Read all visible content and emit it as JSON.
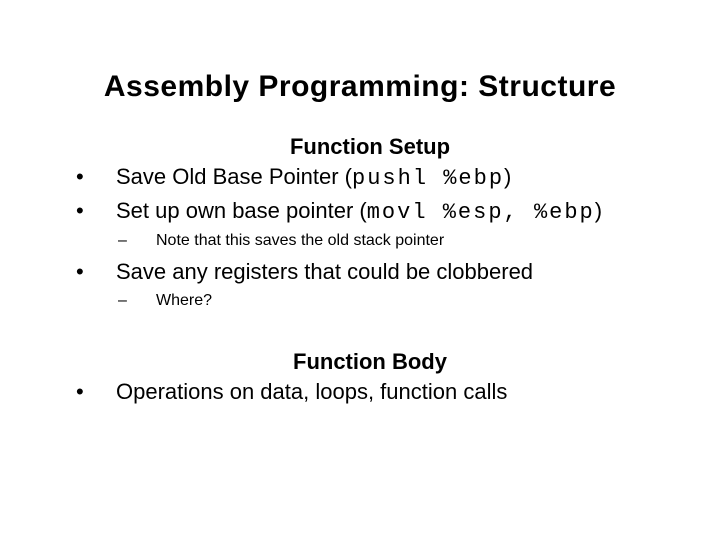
{
  "title": "Assembly Programming: Structure",
  "section1": {
    "heading": "Function Setup",
    "bullets": [
      {
        "pre": "Save Old Base Pointer (",
        "code": "pushl %ebp",
        "post": ")"
      },
      {
        "pre": "Set up own base pointer (",
        "code": "movl %esp, %ebp",
        "post": ")"
      }
    ],
    "sub_after_b2": "Note that this saves the old stack pointer",
    "bullet3": "Save any registers that could be clobbered",
    "sub_after_b3": "Where?"
  },
  "section2": {
    "heading": "Function Body",
    "bullet": "Operations on data, loops, function calls"
  }
}
